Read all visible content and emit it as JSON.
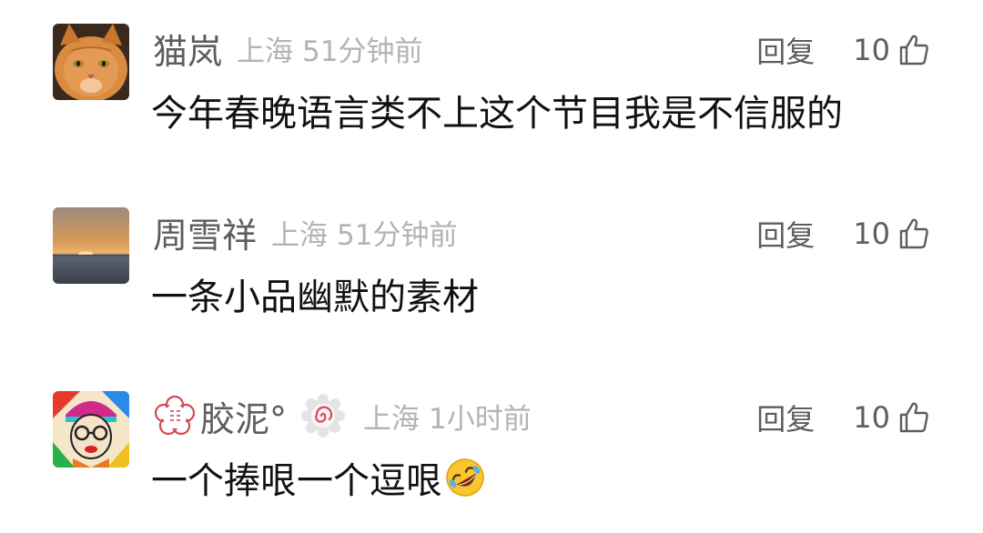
{
  "comments": [
    {
      "username": "猫岚",
      "location": "上海",
      "time": "51分钟前",
      "reply_label": "回复",
      "likes": "10",
      "text": "今年春晚语言类不上这个节目我是不信服的",
      "avatar_icon": "cat-photo"
    },
    {
      "username": "周雪祥",
      "location": "上海",
      "time": "51分钟前",
      "reply_label": "回复",
      "likes": "10",
      "text": "一条小品幽默的素材",
      "avatar_icon": "sunset-photo"
    },
    {
      "username": "胶泥°",
      "location": "上海",
      "time": "1小时前",
      "reply_label": "回复",
      "likes": "10",
      "text": "一个捧哏一个逗哏",
      "avatar_icon": "cartoon-face",
      "name_badge_icon": "sakura-stamp-icon",
      "level_badge_icon": "swirl-badge-icon",
      "text_emoji": "rolling-laughing-emoji"
    }
  ],
  "colors": {
    "username": "#5d5d5d",
    "meta": "#b3b3b3",
    "text": "#111111",
    "action": "#5d5d5d"
  }
}
